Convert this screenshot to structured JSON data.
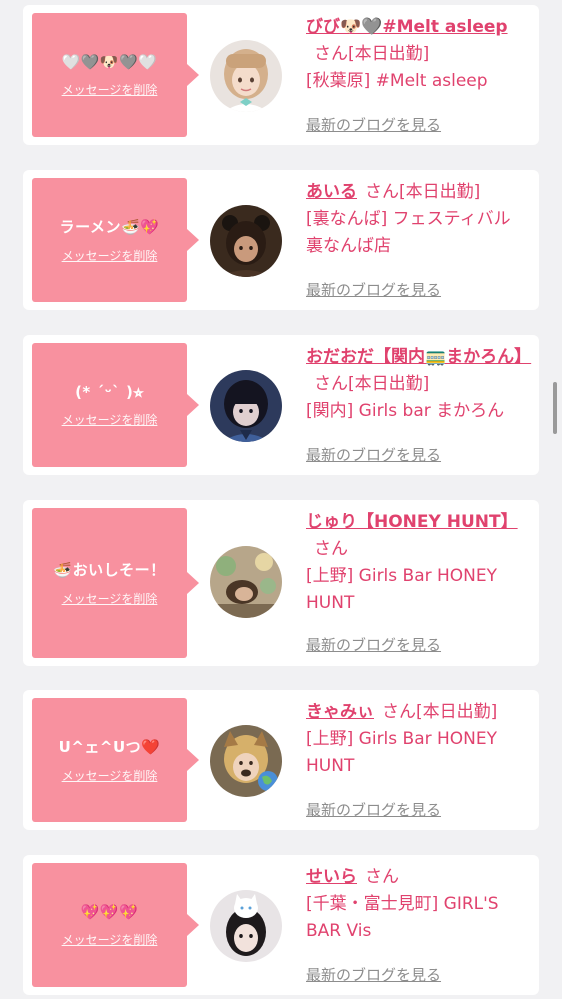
{
  "colors": {
    "accent": "#e0426e",
    "bubble": "#f8919f",
    "card": "#ffffff",
    "page_bg": "#f1f1f3",
    "link_gray": "#8d8d8d"
  },
  "delete_label": "メッセージを削除",
  "blog_label": "最新のブログを見る",
  "entries": [
    {
      "message": "🤍🩶🐶🩶🤍",
      "name": "びび🐶🩶#Melt asleep",
      "san": "さん[本日出勤]",
      "shop": "[秋葉原] #Melt asleep",
      "avatar_icon": "avatar-photo-girl-blond-hair"
    },
    {
      "message": "ラーメン🍜💖",
      "name": "あいる",
      "san": "さん[本日出勤]",
      "shop": "[裏なんば] フェスティバル 裏なんば店",
      "avatar_icon": "avatar-photo-girl-dark-hair-ears"
    },
    {
      "message": "(* ´ᵕ` )⭐︎",
      "name": "おだおだ【関内🚃まかろん】",
      "san": "さん[本日出勤]",
      "shop": "[関内] Girls bar まかろん",
      "avatar_icon": "avatar-photo-girl-dark-hair-bangs"
    },
    {
      "message": "🍜おいしそー！",
      "name": "じゅり【HONEY HUNT】",
      "san": "さん",
      "shop": "[上野] Girls Bar HONEY HUNT",
      "avatar_icon": "avatar-photo-party-balloons"
    },
    {
      "message": "U^ェ^Uつ❤️",
      "name": "きゃみぃ",
      "san": "さん[本日出勤]",
      "shop": "[上野] Girls Bar HONEY HUNT",
      "avatar_icon": "avatar-photo-girl-dog-filter"
    },
    {
      "message": "💖💖💖",
      "name": "せいら",
      "san": "さん",
      "shop": "[千葉・富士見町] GIRL'S BAR Vis",
      "avatar_icon": "avatar-photo-girl-cat-filter"
    }
  ]
}
